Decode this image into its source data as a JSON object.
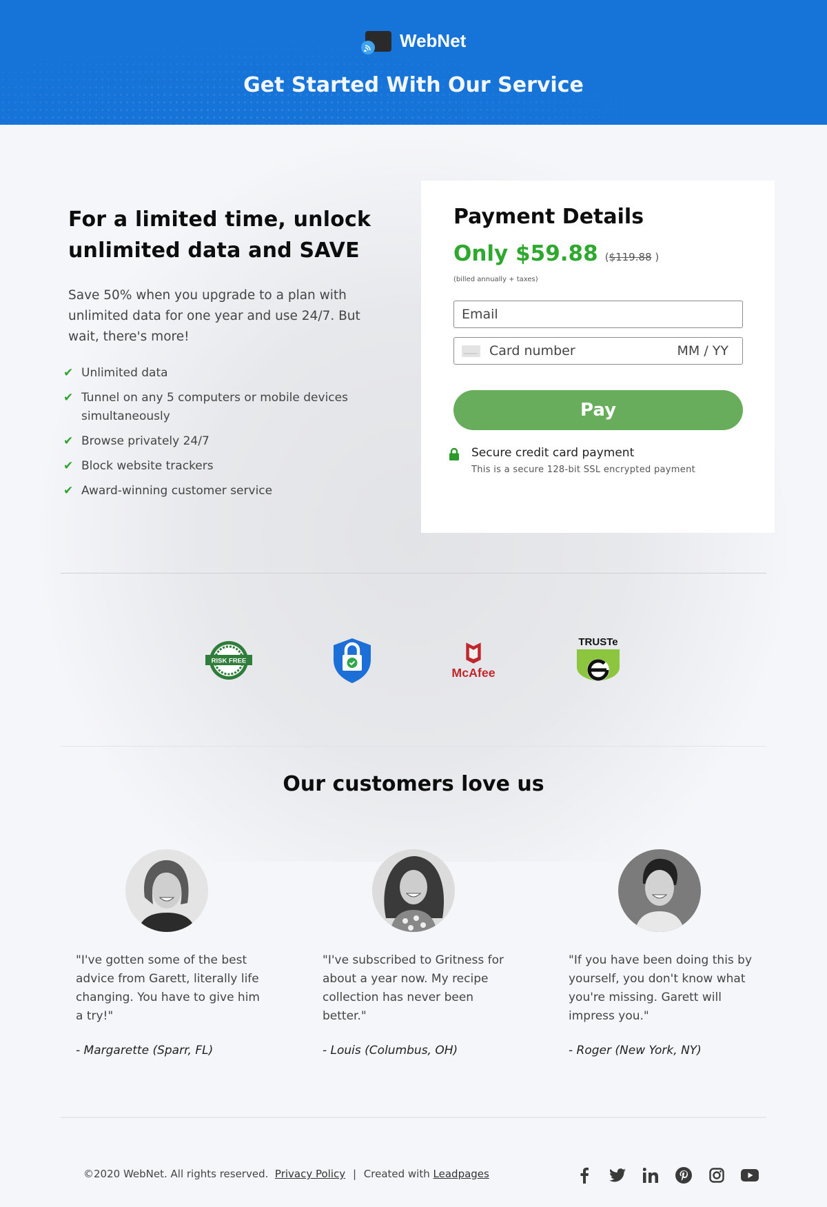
{
  "brand": {
    "name": "WebNet",
    "logo_icon": "wifi-device-icon",
    "accent": "#1673d8"
  },
  "hero": {
    "title": "Get Started With Our Service"
  },
  "offer": {
    "headline": "For a limited time, unlock unlimited data and SAVE",
    "lead": "Save 50% when you upgrade to a plan with unlimited data for one year and use 24/7. But wait, there's more!",
    "features": [
      "Unlimited data",
      "Tunnel on any 5 computers or mobile devices simultaneously",
      "Browse privately 24/7",
      "Block website trackers",
      "Award-winning customer service"
    ]
  },
  "payment": {
    "title": "Payment Details",
    "price": "Only $59.88",
    "original_price": "$119.88",
    "billing_note": "(billed annually + taxes)",
    "email_placeholder": "Email",
    "card_placeholder": "Card number",
    "expiry_placeholder": "MM / YY",
    "pay_label": "Pay",
    "pay_color": "#67ad5b",
    "price_color": "#2ea82e",
    "secure_title": "Secure credit card payment",
    "secure_subtitle": "This is a secure 128-bit SSL encrypted payment"
  },
  "trust_badges": [
    {
      "name": "risk-free-guaranteed-badge",
      "label": "RISK FREE"
    },
    {
      "name": "secure-shield-badge",
      "label": ""
    },
    {
      "name": "mcafee-badge",
      "label": "McAfee"
    },
    {
      "name": "truste-badge",
      "label": "TRUSTe"
    }
  ],
  "testimonials": {
    "title": "Our customers love us",
    "items": [
      {
        "quote": "\"I've gotten some of the best advice from Garett, literally life changing. You have to give him a try!\"",
        "author": "- Margarette (Sparr, FL)"
      },
      {
        "quote": "\"I've subscribed to Gritness for about a year now.  My recipe collection has never been better.\"",
        "author": "- Louis (Columbus, OH)"
      },
      {
        "quote": "\"If you have been doing this by yourself, you don't know what you're missing. Garett will impress you.\"",
        "author": "- Roger (New York, NY)"
      }
    ]
  },
  "footer": {
    "copyright": "©2020 WebNet. All rights reserved.",
    "privacy_label": "Privacy Policy",
    "separator": "|",
    "created_with": "Created with",
    "leadpages_label": "Leadpages",
    "social": [
      "facebook",
      "twitter",
      "linkedin",
      "pinterest",
      "instagram",
      "youtube"
    ]
  }
}
